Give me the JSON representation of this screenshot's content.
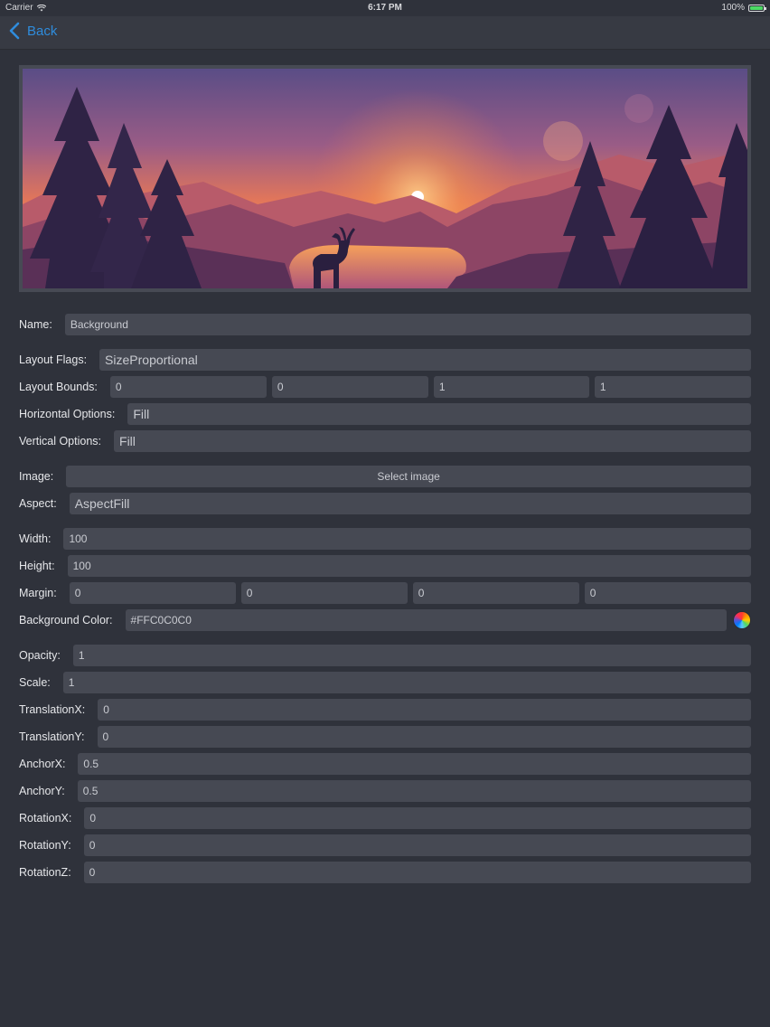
{
  "status": {
    "carrier": "Carrier",
    "time": "6:17 PM",
    "battery": "100%"
  },
  "nav": {
    "back_label": "Back"
  },
  "form": {
    "name": {
      "label": "Name:",
      "value": "Background"
    },
    "layout_flags": {
      "label": "Layout Flags:",
      "value": "SizeProportional"
    },
    "layout_bounds": {
      "label": "Layout Bounds:",
      "values": [
        "0",
        "0",
        "1",
        "1"
      ]
    },
    "horizontal_options": {
      "label": "Horizontal Options:",
      "value": "Fill"
    },
    "vertical_options": {
      "label": "Vertical Options:",
      "value": "Fill"
    },
    "image": {
      "label": "Image:",
      "button": "Select image"
    },
    "aspect": {
      "label": "Aspect:",
      "value": "AspectFill"
    },
    "width": {
      "label": "Width:",
      "value": "100"
    },
    "height": {
      "label": "Height:",
      "value": "100"
    },
    "margin": {
      "label": "Margin:",
      "values": [
        "0",
        "0",
        "0",
        "0"
      ]
    },
    "background_color": {
      "label": "Background Color:",
      "value": "#FFC0C0C0"
    },
    "opacity": {
      "label": "Opacity:",
      "value": "1"
    },
    "scale": {
      "label": "Scale:",
      "value": "1"
    },
    "translation_x": {
      "label": "TranslationX:",
      "value": "0"
    },
    "translation_y": {
      "label": "TranslationY:",
      "value": "0"
    },
    "anchor_x": {
      "label": "AnchorX:",
      "value": "0.5"
    },
    "anchor_y": {
      "label": "AnchorY:",
      "value": "0.5"
    },
    "rotation_x": {
      "label": "RotationX:",
      "value": "0"
    },
    "rotation_y": {
      "label": "RotationY:",
      "value": "0"
    },
    "rotation_z": {
      "label": "RotationZ:",
      "value": "0"
    }
  },
  "colors": {
    "accent": "#2f8cdc",
    "background": "#2f323b",
    "field": "#464953"
  },
  "icons": {
    "back": "chevron-left-icon",
    "wifi": "wifi-icon",
    "battery": "battery-icon",
    "color_picker": "color-wheel-icon"
  }
}
